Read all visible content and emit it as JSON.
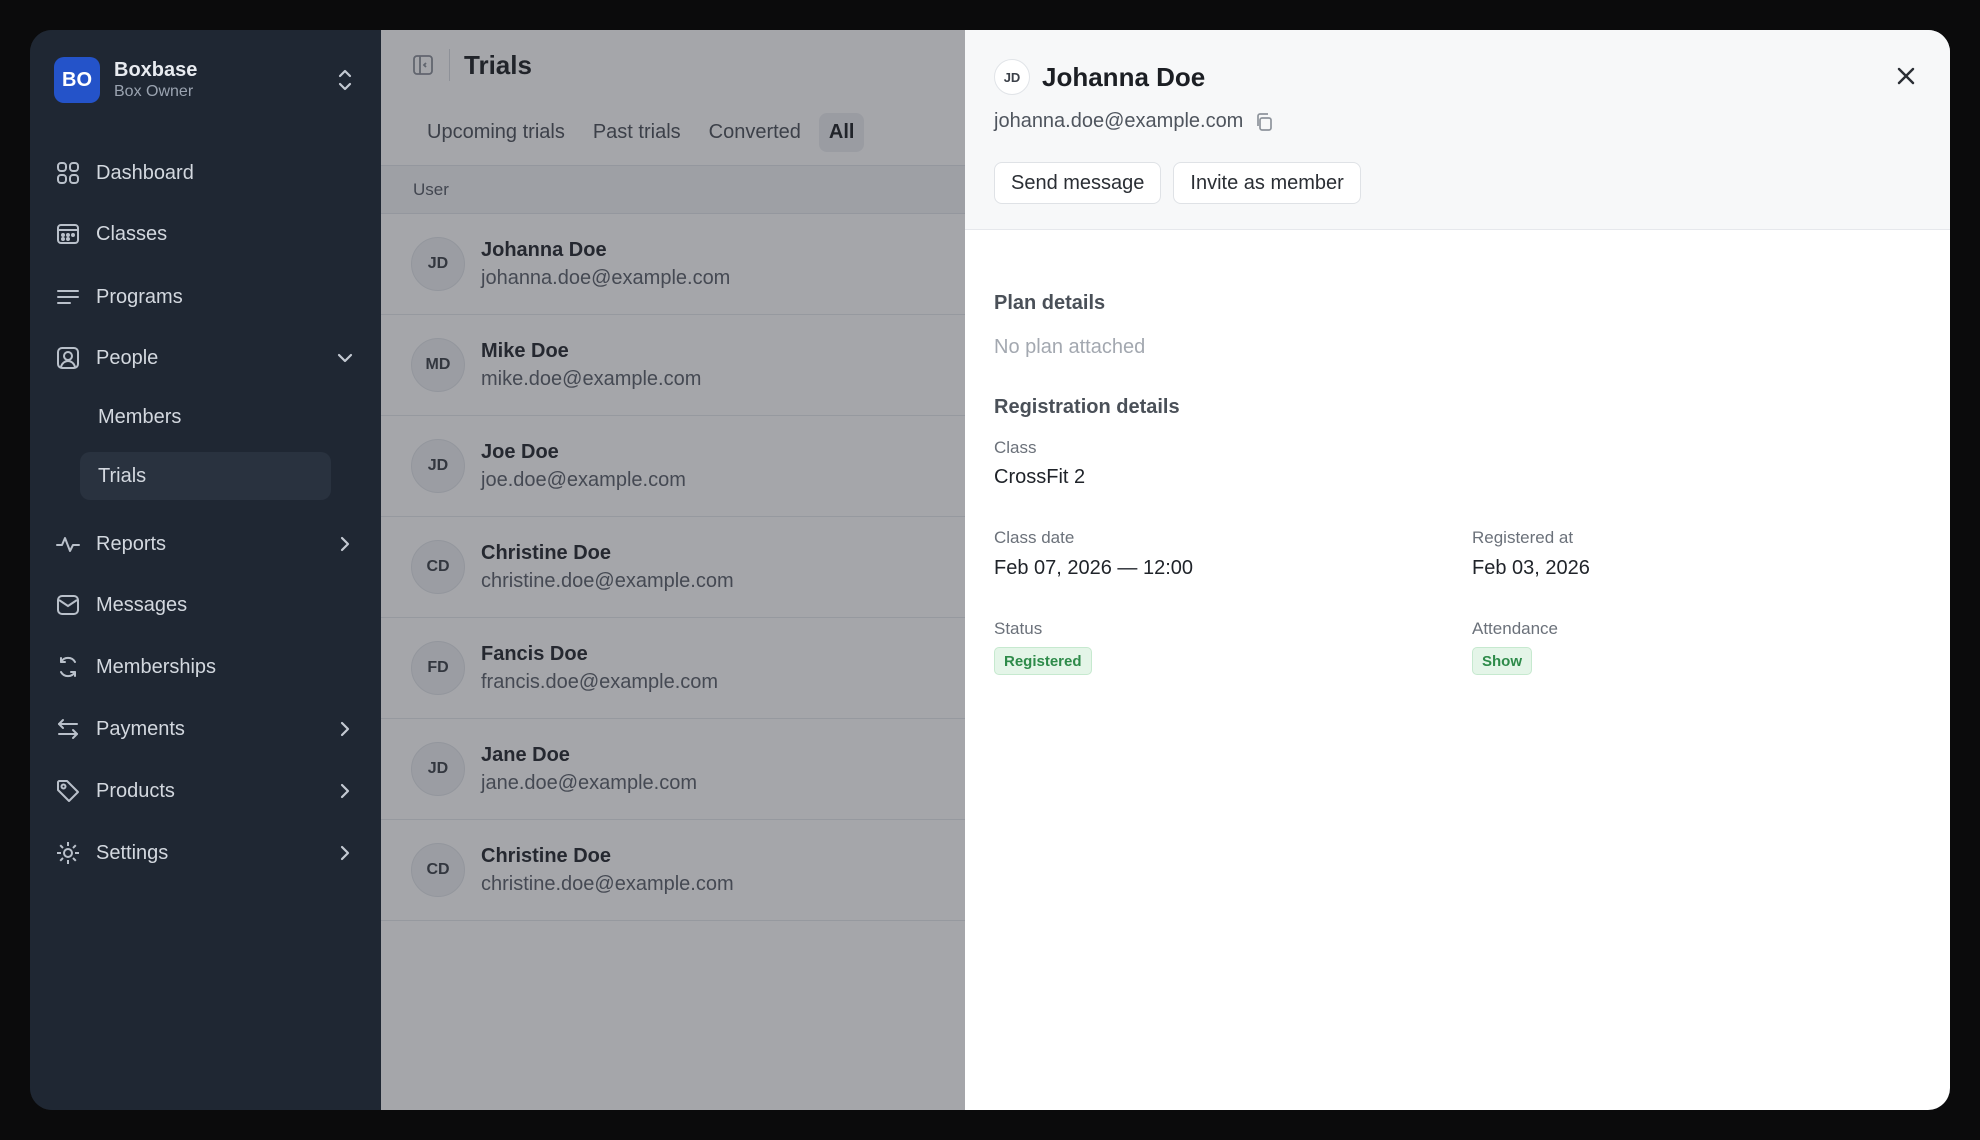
{
  "account": {
    "initials": "BO",
    "name": "Boxbase",
    "role": "Box Owner"
  },
  "sidebar": {
    "dashboard": "Dashboard",
    "classes": "Classes",
    "programs": "Programs",
    "people": "People",
    "members": "Members",
    "trials": "Trials",
    "reports": "Reports",
    "messages": "Messages",
    "memberships": "Memberships",
    "payments": "Payments",
    "products": "Products",
    "settings": "Settings"
  },
  "list": {
    "title": "Trials",
    "tabs": [
      "Upcoming trials",
      "Past trials",
      "Converted",
      "All"
    ],
    "active_tab": "All",
    "column_header": "User",
    "rows": [
      {
        "initials": "JD",
        "name": "Johanna Doe",
        "email": "johanna.doe@example.com"
      },
      {
        "initials": "MD",
        "name": "Mike Doe",
        "email": "mike.doe@example.com"
      },
      {
        "initials": "JD",
        "name": "Joe Doe",
        "email": "joe.doe@example.com"
      },
      {
        "initials": "CD",
        "name": "Christine Doe",
        "email": "christine.doe@example.com"
      },
      {
        "initials": "FD",
        "name": "Fancis Doe",
        "email": "francis.doe@example.com"
      },
      {
        "initials": "JD",
        "name": "Jane Doe",
        "email": "jane.doe@example.com"
      },
      {
        "initials": "CD",
        "name": "Christine Doe",
        "email": "christine.doe@example.com"
      }
    ]
  },
  "detail": {
    "initials": "JD",
    "name": "Johanna Doe",
    "email": "johanna.doe@example.com",
    "send_message": "Send message",
    "invite_member": "Invite as member",
    "plan_title": "Plan details",
    "plan_empty": "No plan attached",
    "registration_title": "Registration details",
    "class_label": "Class",
    "class_value": "CrossFit 2",
    "class_date_label": "Class date",
    "class_date_value": "Feb 07, 2026 — 12:00",
    "registered_at_label": "Registered at",
    "registered_at_value": "Feb 03, 2026",
    "status_label": "Status",
    "status_value": "Registered",
    "attendance_label": "Attendance",
    "attendance_value": "Show"
  },
  "colors": {
    "accent": "#2453c9",
    "sidebar_bg": "#1f2733",
    "success_bg": "#e4f5e8",
    "success_text": "#2e8b4a"
  }
}
